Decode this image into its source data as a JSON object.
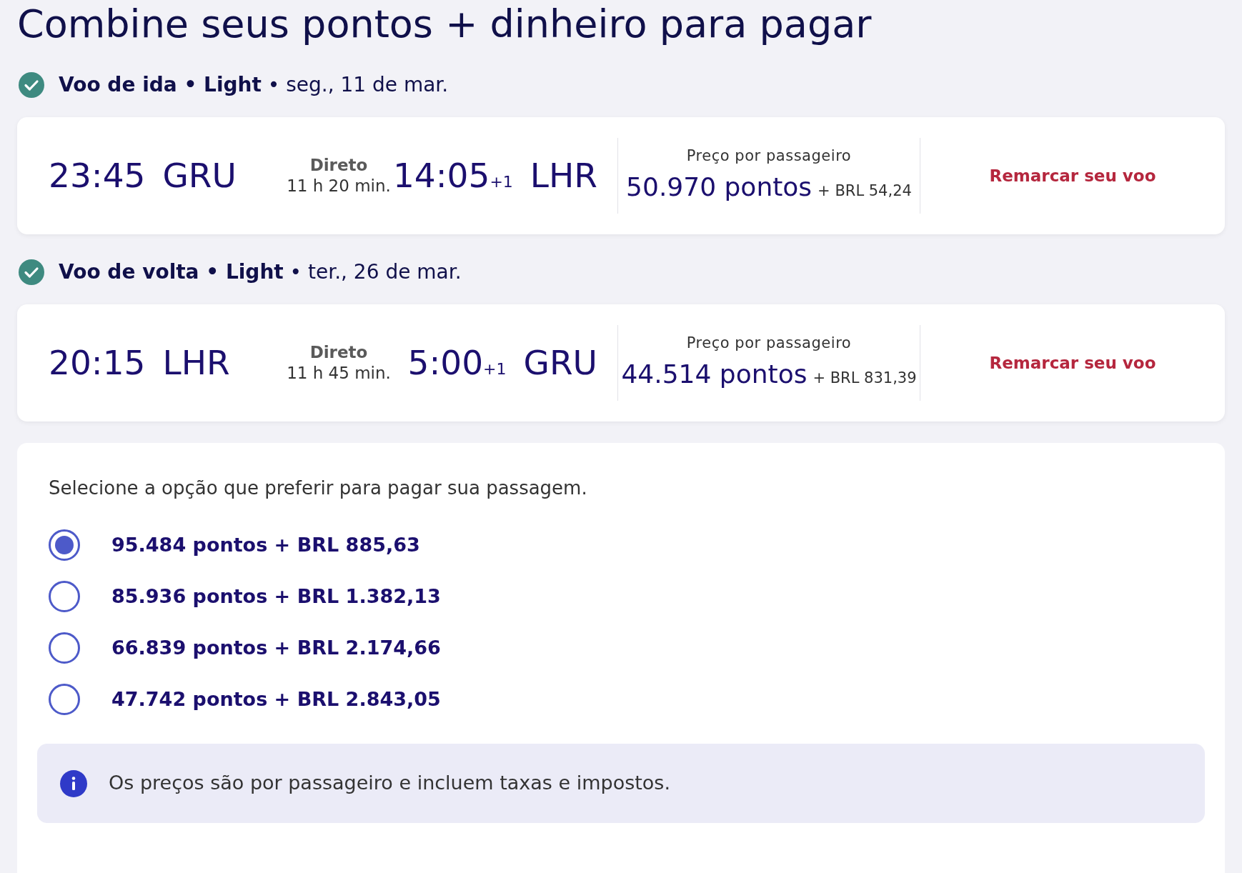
{
  "title": "Combine seus pontos + dinheiro para pagar",
  "flights": [
    {
      "header": "**Voo de ida • Light** • seg., 11 de mar.",
      "confirmed": true,
      "departure_time": "23:45",
      "departure_airport": "GRU",
      "stops": "Direto",
      "duration": "11 h 20 min.",
      "arrival_time": "14:05",
      "day_offset": "+1",
      "arrival_airport": "LHR",
      "price_label": "Preço por passageiro",
      "points": "50.970 pontos",
      "cash": "+ BRL 54,24",
      "action": "Remarcar seu voo"
    },
    {
      "header": "**Voo de volta • Light** • ter., 26 de mar.",
      "confirmed": true,
      "departure_time": "20:15",
      "departure_airport": "LHR",
      "stops": "Direto",
      "duration": "11 h 45 min.",
      "arrival_time": "5:00",
      "day_offset": "+1",
      "arrival_airport": "GRU",
      "price_label": "Preço por passageiro",
      "points": "44.514 pontos",
      "cash": "+ BRL 831,39",
      "action": "Remarcar seu voo"
    }
  ],
  "payment": {
    "prompt": "Selecione a opção que preferir para pagar sua passagem.",
    "options": [
      {
        "label": "95.484 pontos + BRL 885,63",
        "selected": true
      },
      {
        "label": "85.936 pontos + BRL 1.382,13",
        "selected": false
      },
      {
        "label": "66.839 pontos + BRL 2.174,66",
        "selected": false
      },
      {
        "label": "47.742 pontos + BRL 2.843,05",
        "selected": false
      }
    ],
    "note": "Os preços são por passageiro e incluem taxas e impostos."
  }
}
